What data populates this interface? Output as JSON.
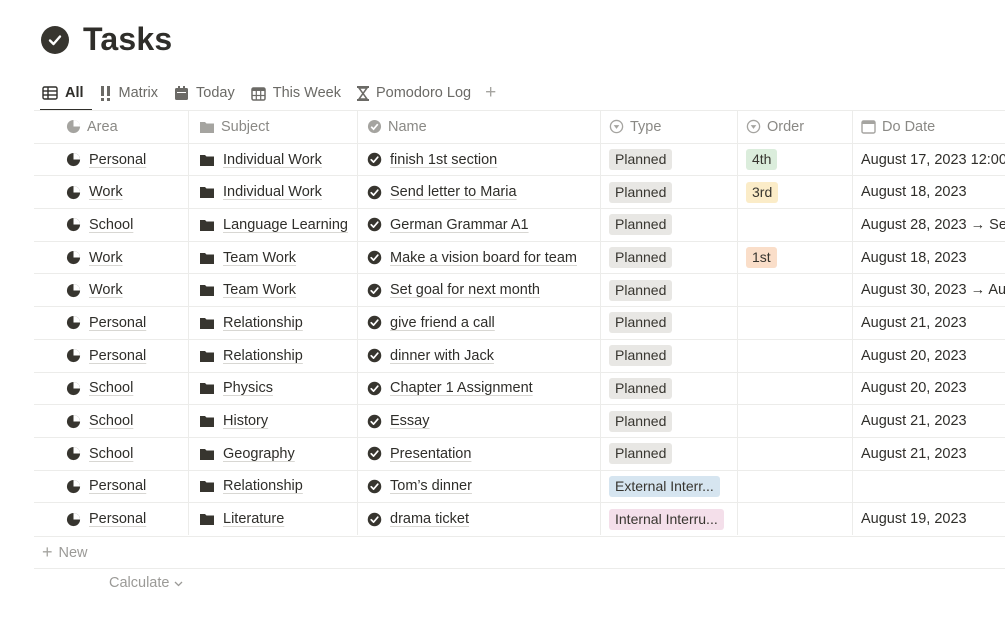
{
  "page": {
    "title": "Tasks"
  },
  "tabs": [
    {
      "label": "All",
      "icon": "table-icon",
      "active": true
    },
    {
      "label": "Matrix",
      "icon": "exclamation-icon"
    },
    {
      "label": "Today",
      "icon": "calendar-icon"
    },
    {
      "label": "This Week",
      "icon": "calendar-grid-icon"
    },
    {
      "label": "Pomodoro Log",
      "icon": "hourglass-icon"
    }
  ],
  "tab_add": "+",
  "columns": {
    "area": "Area",
    "subject": "Subject",
    "name": "Name",
    "type": "Type",
    "order": "Order",
    "date": "Do Date"
  },
  "rows": [
    {
      "area": "Personal",
      "subject": "Individual Work",
      "name": "finish 1st section",
      "type": "Planned",
      "type_color": "gray",
      "order": "4th",
      "order_color": "green",
      "date": "August 17, 2023 12:00"
    },
    {
      "area": "Work",
      "subject": "Individual Work",
      "name": "Send letter to Maria",
      "type": "Planned",
      "type_color": "gray",
      "order": "3rd",
      "order_color": "yellow",
      "date": "August 18, 2023"
    },
    {
      "area": "School",
      "subject": "Language Learning",
      "name": "German Grammar A1",
      "type": "Planned",
      "type_color": "gray",
      "order": "",
      "order_color": "",
      "date": "August 28, 2023 → Se"
    },
    {
      "area": "Work",
      "subject": "Team Work",
      "name": "Make a vision board for team",
      "type": "Planned",
      "type_color": "gray",
      "order": "1st",
      "order_color": "orange",
      "date": "August 18, 2023"
    },
    {
      "area": "Work",
      "subject": "Team Work",
      "name": "Set goal for next month",
      "type": "Planned",
      "type_color": "gray",
      "order": "",
      "order_color": "",
      "date": "August 30, 2023 → Au"
    },
    {
      "area": "Personal",
      "subject": "Relationship",
      "name": "give friend a call",
      "type": "Planned",
      "type_color": "gray",
      "order": "",
      "order_color": "",
      "date": "August 21, 2023"
    },
    {
      "area": "Personal",
      "subject": "Relationship",
      "name": "dinner with Jack",
      "type": "Planned",
      "type_color": "gray",
      "order": "",
      "order_color": "",
      "date": "August 20, 2023"
    },
    {
      "area": "School",
      "subject": "Physics",
      "name": "Chapter 1 Assignment",
      "type": "Planned",
      "type_color": "gray",
      "order": "",
      "order_color": "",
      "date": "August 20, 2023"
    },
    {
      "area": "School",
      "subject": "History",
      "name": "Essay",
      "type": "Planned",
      "type_color": "gray",
      "order": "",
      "order_color": "",
      "date": "August 21, 2023"
    },
    {
      "area": "School",
      "subject": "Geography",
      "name": "Presentation",
      "type": "Planned",
      "type_color": "gray",
      "order": "",
      "order_color": "",
      "date": "August 21, 2023"
    },
    {
      "area": "Personal",
      "subject": "Relationship",
      "name": "Tom’s dinner",
      "type": "External Interr...",
      "type_color": "blue",
      "order": "",
      "order_color": "",
      "date": ""
    },
    {
      "area": "Personal",
      "subject": "Literature",
      "name": "drama ticket",
      "type": "Internal Interru...",
      "type_color": "pink",
      "order": "",
      "order_color": "",
      "date": "August 19, 2023"
    }
  ],
  "new_row_label": "New",
  "calculate_label": "Calculate",
  "colors": {
    "text": "#37352f",
    "border": "#ececea",
    "muted": "#9b9a97"
  }
}
